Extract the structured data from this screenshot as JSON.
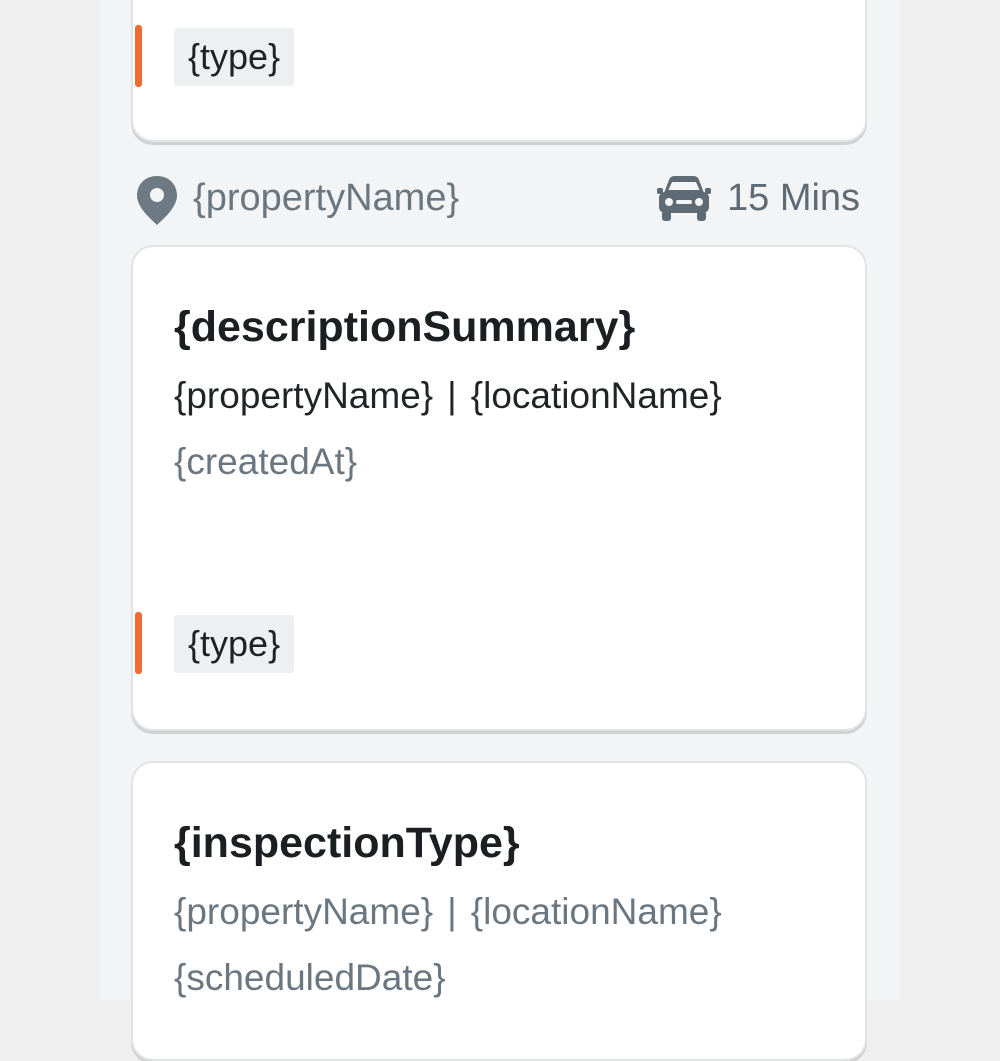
{
  "cards": [
    {
      "type": "{type}"
    },
    {
      "title": "{descriptionSummary}",
      "property": "{propertyName}",
      "separator": "|",
      "location": "{locationName}",
      "date": "{createdAt}",
      "type": "{type}"
    },
    {
      "title": "{inspectionType}",
      "property": "{propertyName}",
      "separator": "|",
      "location": "{locationName}",
      "date": "{scheduledDate}"
    }
  ],
  "meta": {
    "property_name": "{propertyName}",
    "travel_time": "15 Mins",
    "pin_icon": "location-pin-icon",
    "car_icon": "car-icon"
  },
  "colors": {
    "accent": "#f26b33",
    "icon": "#5f6b74",
    "muted_text": "#6b7780"
  }
}
